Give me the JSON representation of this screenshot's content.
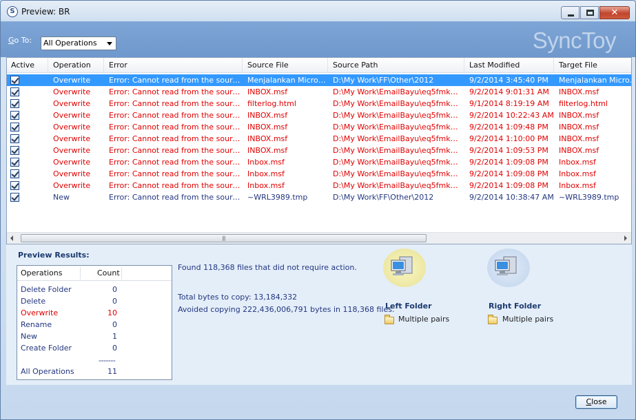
{
  "window": {
    "title": "Preview: BR",
    "logo": "SyncToy",
    "colors": {
      "error_red": "#e00000",
      "new_blue": "#23367f",
      "selection": "#3399ff",
      "header_band": "#7ea5d6"
    }
  },
  "goto": {
    "label_accel": "G",
    "label_rest": "o To:",
    "selected": "All Operations"
  },
  "grid": {
    "headers": [
      "Active",
      "Operation",
      "Error",
      "Source File",
      "Source Path",
      "Last Modified",
      "Target File"
    ],
    "rows": [
      {
        "op": "Overwrite",
        "error": "Error: Cannot read from the source ...",
        "file": "Menjalankan Microso...",
        "path": "D:\\My Work\\FF\\Other\\2012",
        "modified": "9/2/2014 3:45:40 PM",
        "target": "Menjalankan Microsoft",
        "selected": true,
        "kind": "red"
      },
      {
        "op": "Overwrite",
        "error": "Error: Cannot read from the source ...",
        "file": "INBOX.msf",
        "path": "D:\\My Work\\EmailBayu\\eq5fmkmu.d...",
        "modified": "9/2/2014 9:01:31 AM",
        "target": "INBOX.msf",
        "selected": false,
        "kind": "red"
      },
      {
        "op": "Overwrite",
        "error": "Error: Cannot read from the source ...",
        "file": "filterlog.html",
        "path": "D:\\My Work\\EmailBayu\\eq5fmkmu.d...",
        "modified": "9/1/2014 8:19:19 AM",
        "target": "filterlog.html",
        "selected": false,
        "kind": "red"
      },
      {
        "op": "Overwrite",
        "error": "Error: Cannot read from the source ...",
        "file": "INBOX.msf",
        "path": "D:\\My Work\\EmailBayu\\eq5fmkmu.d...",
        "modified": "9/2/2014 10:22:43 AM",
        "target": "INBOX.msf",
        "selected": false,
        "kind": "red"
      },
      {
        "op": "Overwrite",
        "error": "Error: Cannot read from the source ...",
        "file": "INBOX.msf",
        "path": "D:\\My Work\\EmailBayu\\eq5fmkmu.d...",
        "modified": "9/2/2014 1:09:48 PM",
        "target": "INBOX.msf",
        "selected": false,
        "kind": "red"
      },
      {
        "op": "Overwrite",
        "error": "Error: Cannot read from the source ...",
        "file": "INBOX.msf",
        "path": "D:\\My Work\\EmailBayu\\eq5fmkmu.d...",
        "modified": "9/2/2014 1:10:00 PM",
        "target": "INBOX.msf",
        "selected": false,
        "kind": "red"
      },
      {
        "op": "Overwrite",
        "error": "Error: Cannot read from the source ...",
        "file": "INBOX.msf",
        "path": "D:\\My Work\\EmailBayu\\eq5fmkmu.d...",
        "modified": "9/2/2014 1:09:53 PM",
        "target": "INBOX.msf",
        "selected": false,
        "kind": "red"
      },
      {
        "op": "Overwrite",
        "error": "Error: Cannot read from the source ...",
        "file": "Inbox.msf",
        "path": "D:\\My Work\\EmailBayu\\eq5fmkmu.d...",
        "modified": "9/2/2014 1:09:08 PM",
        "target": "Inbox.msf",
        "selected": false,
        "kind": "red"
      },
      {
        "op": "Overwrite",
        "error": "Error: Cannot read from the source ...",
        "file": "Inbox.msf",
        "path": "D:\\My Work\\EmailBayu\\eq5fmkmu.d...",
        "modified": "9/2/2014 1:09:08 PM",
        "target": "Inbox.msf",
        "selected": false,
        "kind": "red"
      },
      {
        "op": "Overwrite",
        "error": "Error: Cannot read from the source ...",
        "file": "Inbox.msf",
        "path": "D:\\My Work\\EmailBayu\\eq5fmkmu.d...",
        "modified": "9/2/2014 1:09:08 PM",
        "target": "Inbox.msf",
        "selected": false,
        "kind": "red"
      },
      {
        "op": "New",
        "error": "Error: Cannot read from the source ...",
        "file": "~WRL3989.tmp",
        "path": "D:\\My Work\\FF\\Other\\2012",
        "modified": "9/2/2014 10:38:47 AM",
        "target": "~WRL3989.tmp",
        "selected": false,
        "kind": "blue"
      }
    ]
  },
  "results": {
    "title": "Preview Results:",
    "headers": [
      "Operations",
      "Count"
    ],
    "ops": [
      {
        "name": "Delete Folder",
        "count": "0",
        "kind": "blue"
      },
      {
        "name": "Delete",
        "count": "0",
        "kind": "blue"
      },
      {
        "name": "Overwrite",
        "count": "10",
        "kind": "red"
      },
      {
        "name": "Rename",
        "count": "0",
        "kind": "blue"
      },
      {
        "name": "New",
        "count": "1",
        "kind": "blue"
      },
      {
        "name": "Create Folder",
        "count": "0",
        "kind": "blue"
      }
    ],
    "separator": "-------",
    "total": {
      "name": "All Operations",
      "count": "11"
    },
    "found_text": "Found 118,368 files that did not require action.",
    "bytes_text": "Total bytes to copy: 13,184,332",
    "avoided_text": "Avoided copying 222,436,006,791 bytes in 118,368 files."
  },
  "left_folder": {
    "title": "Left Folder",
    "sub": "Multiple pairs"
  },
  "right_folder": {
    "title": "Right Folder",
    "sub": "Multiple pairs"
  },
  "footer": {
    "close_accel": "C",
    "close_rest": "lose"
  }
}
